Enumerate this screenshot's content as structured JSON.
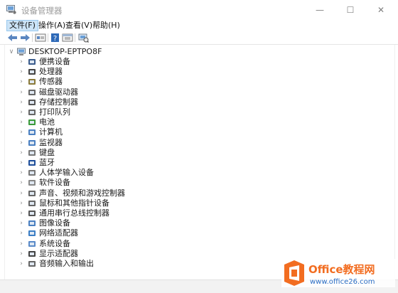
{
  "window": {
    "title": "设备管理器",
    "controls": {
      "minimize": "—",
      "maximize": "☐",
      "close": "✕"
    }
  },
  "menu": [
    "文件(F)",
    "操作(A)",
    "查看(V)",
    "帮助(H)"
  ],
  "toolbar_icons": [
    "back-arrow-icon",
    "forward-arrow-icon",
    "properties-icon",
    "help-icon",
    "view-icon",
    "scan-hardware-icon"
  ],
  "tree": {
    "root": "DESKTOP-EPTPO8F",
    "categories": [
      "便携设备",
      "处理器",
      "传感器",
      "磁盘驱动器",
      "存储控制器",
      "打印队列",
      "电池",
      "计算机",
      "监视器",
      "键盘",
      "蓝牙",
      "人体学输入设备",
      "软件设备",
      "声音、视频和游戏控制器",
      "鼠标和其他指针设备",
      "通用串行总线控制器",
      "图像设备",
      "网络适配器",
      "系统设备",
      "显示适配器",
      "音频输入和输出"
    ]
  },
  "watermark": {
    "brand": "Office教程网",
    "url": "www.office26.com"
  },
  "colors": {
    "menu_highlight": "#cce4f7",
    "watermark_orange": "#f26d21",
    "watermark_blue": "#2b6ec4"
  }
}
